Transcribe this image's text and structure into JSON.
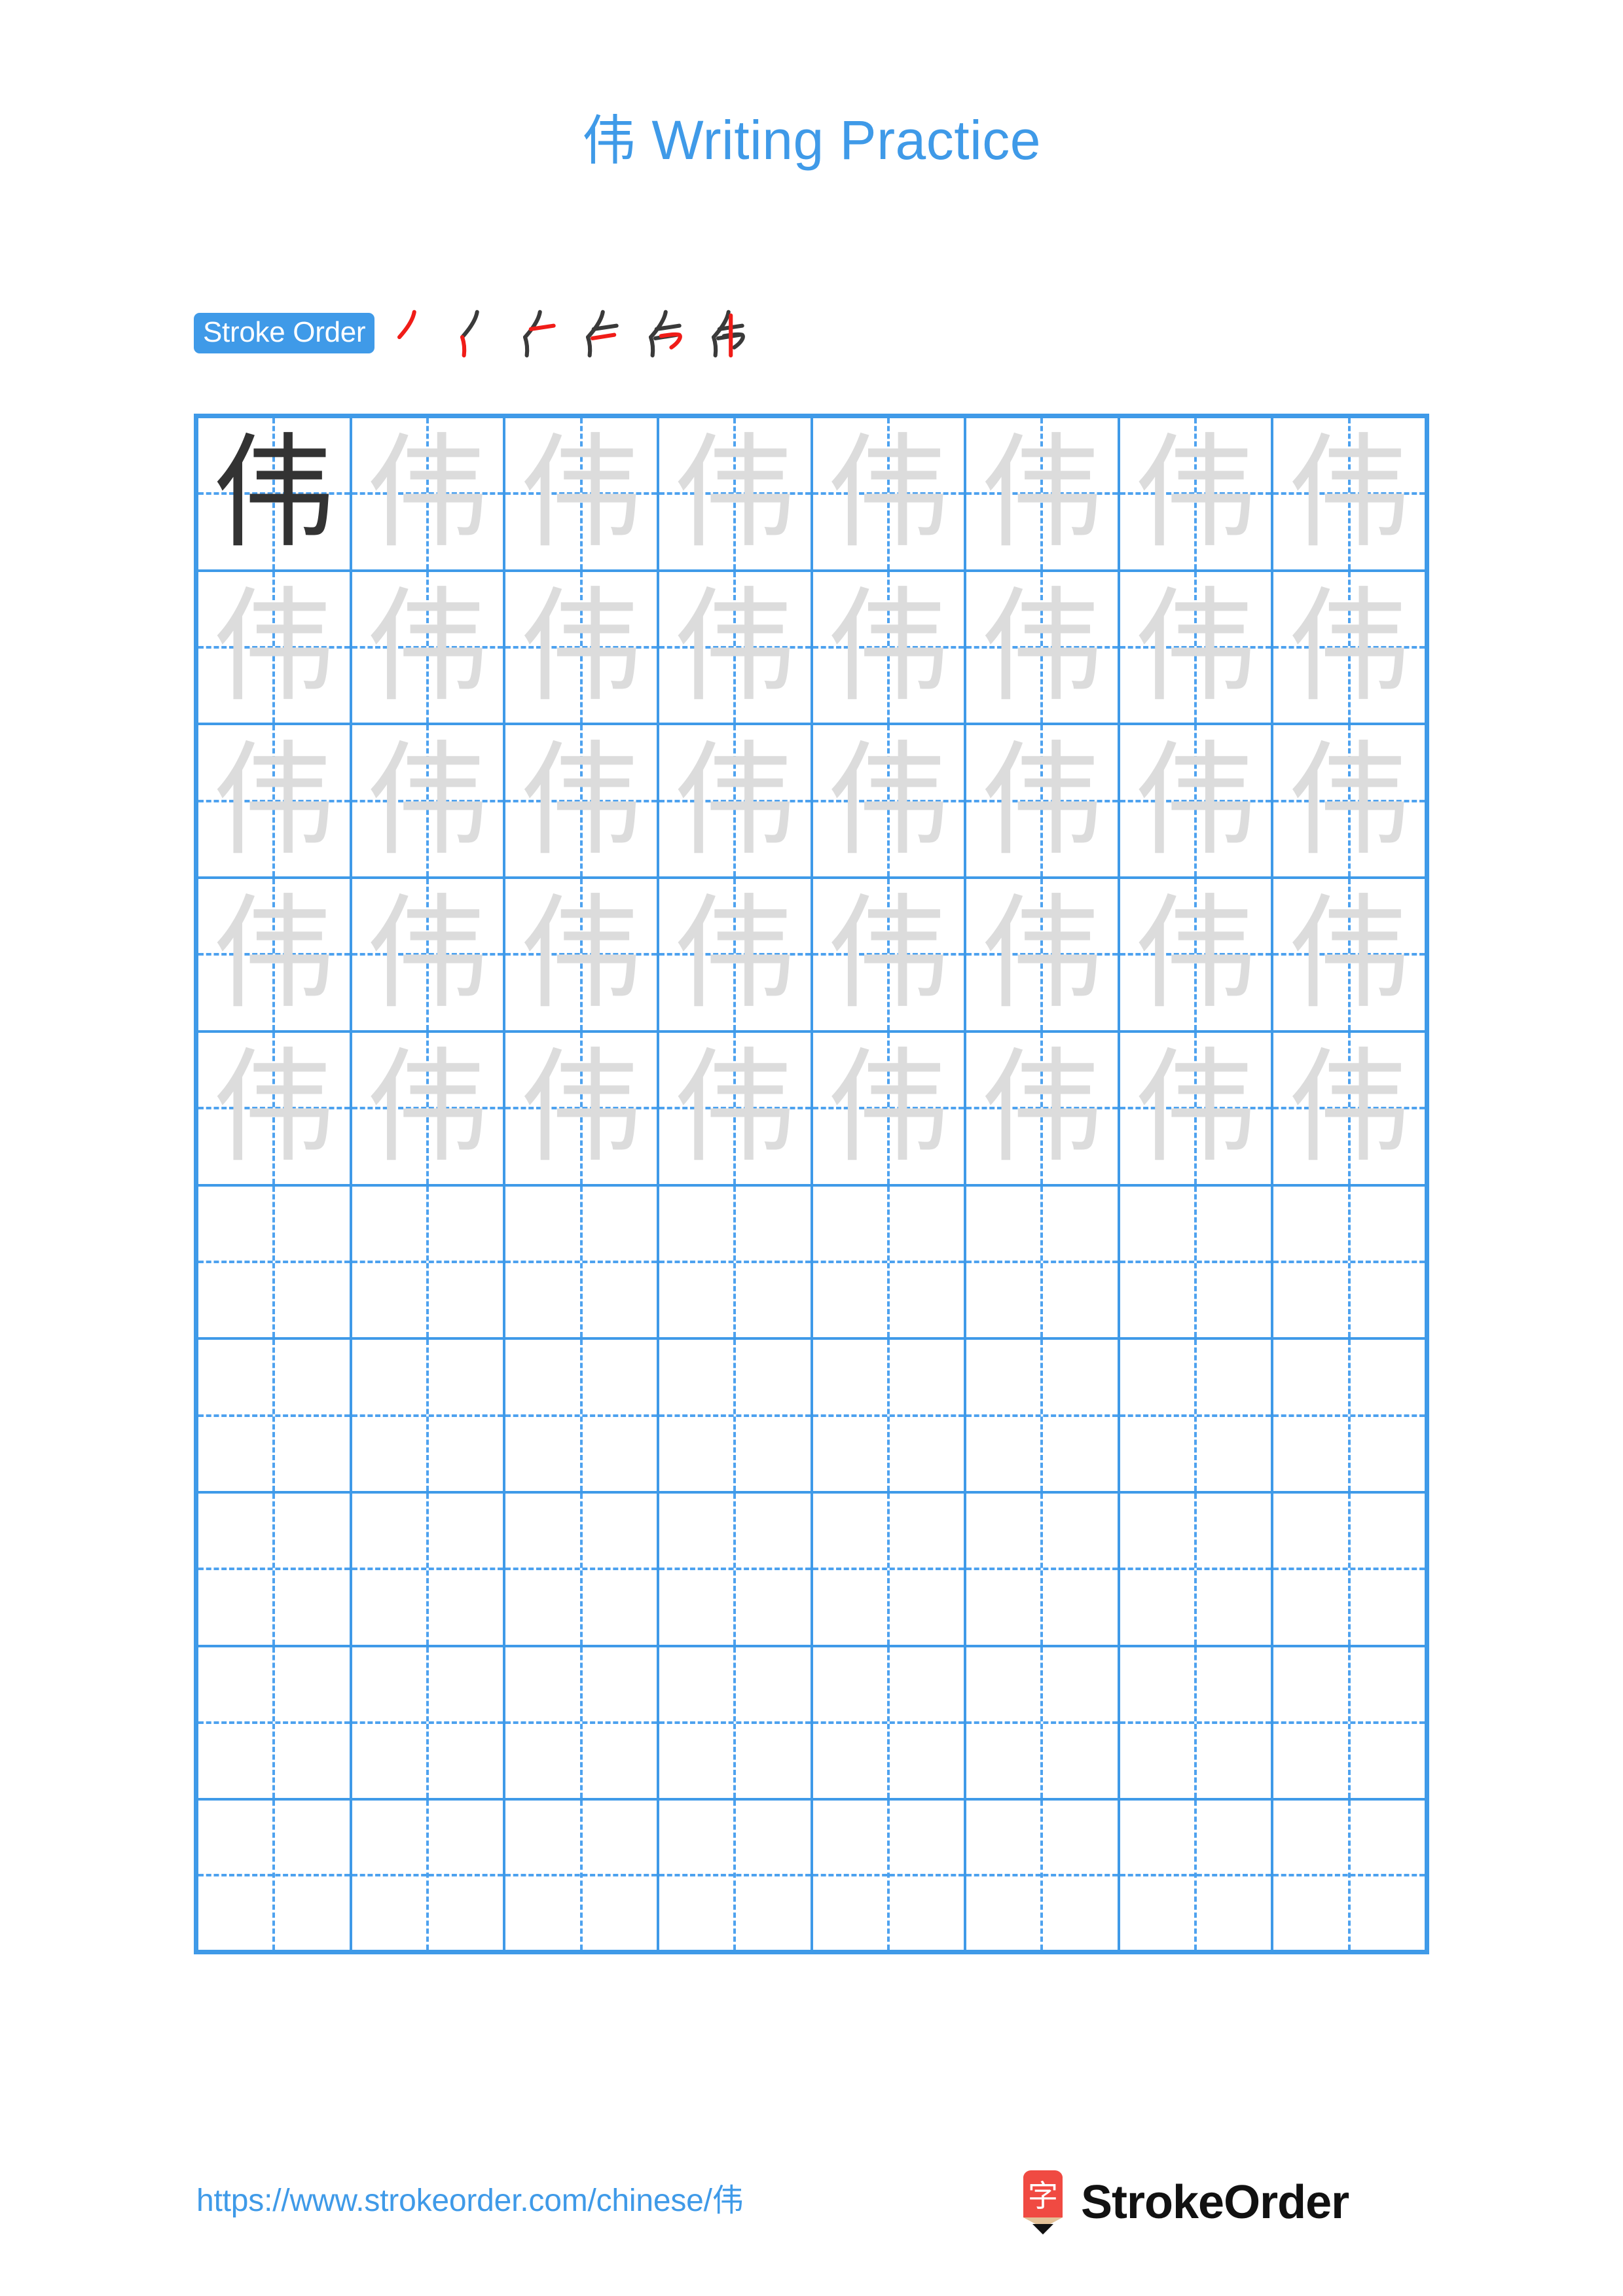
{
  "document": {
    "character": "伟",
    "title_suffix": " Writing Practice",
    "title_full": "伟 Writing Practice"
  },
  "theme": {
    "accent_blue": "#3f9ae8",
    "grid_line": "#3f9ae8",
    "guide_dash": "#4ea2ef",
    "trace_gray": "#dcdcdc",
    "model_dark": "#333333",
    "stroke_done": "#3a3a3a",
    "stroke_new": "#f01c18",
    "logo_red": "#f04a42",
    "logo_wood": "#e3c197"
  },
  "stroke_order": {
    "label": "Stroke Order",
    "total_strokes": 6,
    "steps": [
      {
        "index": 1,
        "name": "stroke-step-1"
      },
      {
        "index": 2,
        "name": "stroke-step-2"
      },
      {
        "index": 3,
        "name": "stroke-step-3"
      },
      {
        "index": 4,
        "name": "stroke-step-4"
      },
      {
        "index": 5,
        "name": "stroke-step-5"
      },
      {
        "index": 6,
        "name": "stroke-step-6"
      }
    ]
  },
  "grid": {
    "columns": 8,
    "rows": 10,
    "filled_rows": 5,
    "model_cell": {
      "row": 1,
      "col": 1
    },
    "cells": [
      [
        "model",
        "trace",
        "trace",
        "trace",
        "trace",
        "trace",
        "trace",
        "trace"
      ],
      [
        "trace",
        "trace",
        "trace",
        "trace",
        "trace",
        "trace",
        "trace",
        "trace"
      ],
      [
        "trace",
        "trace",
        "trace",
        "trace",
        "trace",
        "trace",
        "trace",
        "trace"
      ],
      [
        "trace",
        "trace",
        "trace",
        "trace",
        "trace",
        "trace",
        "trace",
        "trace"
      ],
      [
        "trace",
        "trace",
        "trace",
        "trace",
        "trace",
        "trace",
        "trace",
        "trace"
      ],
      [
        "empty",
        "empty",
        "empty",
        "empty",
        "empty",
        "empty",
        "empty",
        "empty"
      ],
      [
        "empty",
        "empty",
        "empty",
        "empty",
        "empty",
        "empty",
        "empty",
        "empty"
      ],
      [
        "empty",
        "empty",
        "empty",
        "empty",
        "empty",
        "empty",
        "empty",
        "empty"
      ],
      [
        "empty",
        "empty",
        "empty",
        "empty",
        "empty",
        "empty",
        "empty",
        "empty"
      ],
      [
        "empty",
        "empty",
        "empty",
        "empty",
        "empty",
        "empty",
        "empty",
        "empty"
      ]
    ]
  },
  "footer": {
    "url": "https://www.strokeorder.com/chinese/伟",
    "brand_name": "StrokeOrder",
    "logo_char": "字"
  }
}
